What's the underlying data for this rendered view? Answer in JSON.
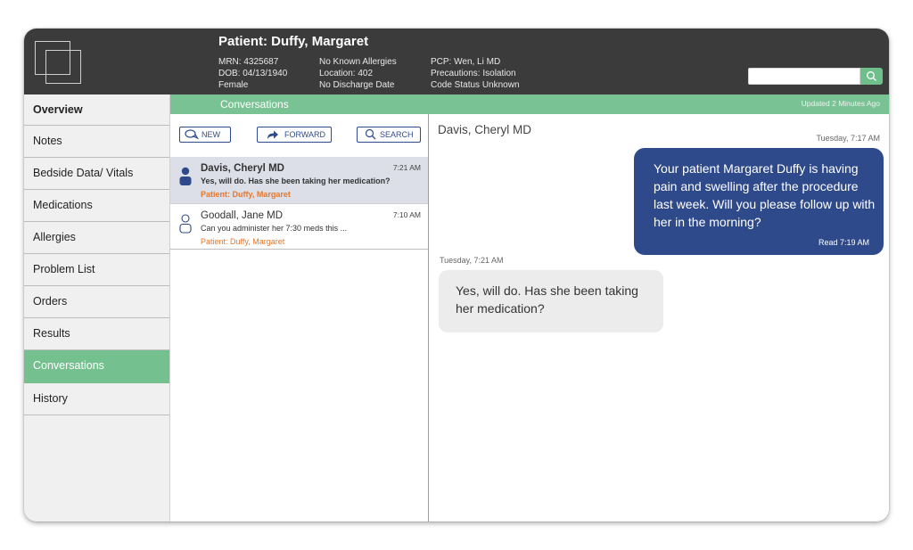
{
  "header": {
    "patient_title": "Patient: Duffy, Margaret",
    "col1": [
      "MRN: 4325687",
      "DOB: 04/13/1940",
      "Female"
    ],
    "col2": [
      "No Known Allergies",
      "Location: 402",
      "No Discharge Date"
    ],
    "col3": [
      "PCP: Wen, Li MD",
      "Precautions: Isolation",
      "Code Status Unknown"
    ],
    "search": {
      "value": "",
      "placeholder": ""
    }
  },
  "sidebar": {
    "items": [
      {
        "label": "Overview"
      },
      {
        "label": "Notes"
      },
      {
        "label": "Bedside Data/ Vitals"
      },
      {
        "label": "Medications"
      },
      {
        "label": "Allergies"
      },
      {
        "label": "Problem List"
      },
      {
        "label": "Orders"
      },
      {
        "label": "Results"
      },
      {
        "label": "Conversations"
      },
      {
        "label": "History"
      }
    ]
  },
  "conversations_bar": {
    "title": "Conversations",
    "updated": "Updated 2 Minutes Ago"
  },
  "toolbar": {
    "new_label": "NEW",
    "forward_label": "FORWARD",
    "search_label": "SEARCH"
  },
  "conversation_list": [
    {
      "name": "Davis, Cheryl MD",
      "time": "7:21 AM",
      "preview": "Yes, will do. Has she been taking her medication?",
      "patient": "Patient: Duffy, Margaret"
    },
    {
      "name": "Goodall, Jane MD",
      "time": "7:10 AM",
      "preview": "Can you administer her 7:30 meds this ...",
      "patient": "Patient: Duffy, Margaret"
    }
  ],
  "chat": {
    "contact": "Davis, Cheryl MD",
    "messages": [
      {
        "timestamp": "Tuesday, 7:17 AM",
        "text": "Your patient Margaret Duffy is having pain and swelling after the procedure last week. Will you please follow up with her in the morning?",
        "status": "Read 7:19 AM"
      },
      {
        "timestamp": "Tuesday, 7:21 AM",
        "text": "Yes, will do. Has she been taking her medication?"
      }
    ]
  },
  "colors": {
    "header_bg": "#3b3b3b",
    "accent_green": "#79c294",
    "outgoing_bubble": "#2e4a8b",
    "incoming_bubble": "#ececec",
    "patient_link": "#e8762b"
  },
  "icons": {
    "logo": "overlapping-squares-logo",
    "search": "search-icon",
    "new": "chat-bubble-icon",
    "forward": "forward-arrow-icon",
    "contact_unread": "person-filled-icon",
    "contact_read": "person-outline-icon"
  }
}
